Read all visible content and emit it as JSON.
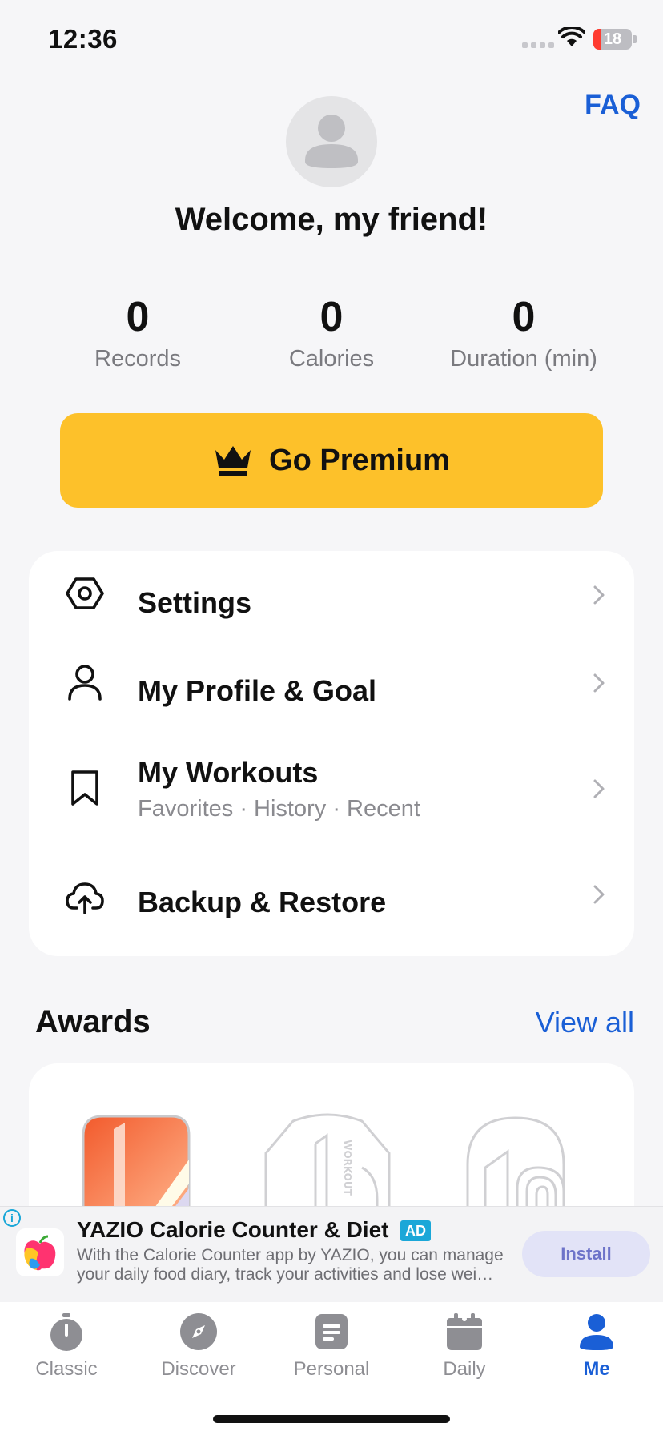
{
  "status_bar": {
    "time": "12:36",
    "battery_level": "18",
    "battery_color": "#ff3b30"
  },
  "header": {
    "faq_label": "FAQ",
    "welcome_text": "Welcome, my friend!"
  },
  "stats": [
    {
      "value": "0",
      "label": "Records"
    },
    {
      "value": "0",
      "label": "Calories"
    },
    {
      "value": "0",
      "label": "Duration (min)"
    }
  ],
  "premium": {
    "label": "Go Premium",
    "icon": "crown-icon",
    "color": "#fdc12a"
  },
  "menu": {
    "items": [
      {
        "title": "Settings",
        "icon": "settings-icon"
      },
      {
        "title": "My Profile & Goal",
        "icon": "profile-icon"
      },
      {
        "title": "My Workouts",
        "subtitle": "Favorites · History · Recent",
        "icon": "bookmark-icon"
      },
      {
        "title": "Backup & Restore",
        "icon": "cloud-upload-icon"
      }
    ]
  },
  "awards": {
    "title": "Awards",
    "view_all_label": "View all"
  },
  "ad": {
    "title": "YAZIO Calorie Counter & Diet",
    "badge": "AD",
    "description_line1": "With the Calorie Counter app by YAZIO, you can manage",
    "description_line2": "your daily food diary, track your activities and lose wei…",
    "install_label": "Install"
  },
  "tabs": [
    {
      "label": "Classic",
      "icon": "stopwatch-icon",
      "active": false
    },
    {
      "label": "Discover",
      "icon": "compass-icon",
      "active": false
    },
    {
      "label": "Personal",
      "icon": "document-icon",
      "active": false
    },
    {
      "label": "Daily",
      "icon": "calendar-icon",
      "active": false
    },
    {
      "label": "Me",
      "icon": "person-icon",
      "active": true
    }
  ],
  "colors": {
    "accent": "#1a5fd6",
    "premium": "#fdc12a",
    "background": "#f6f6f8"
  }
}
